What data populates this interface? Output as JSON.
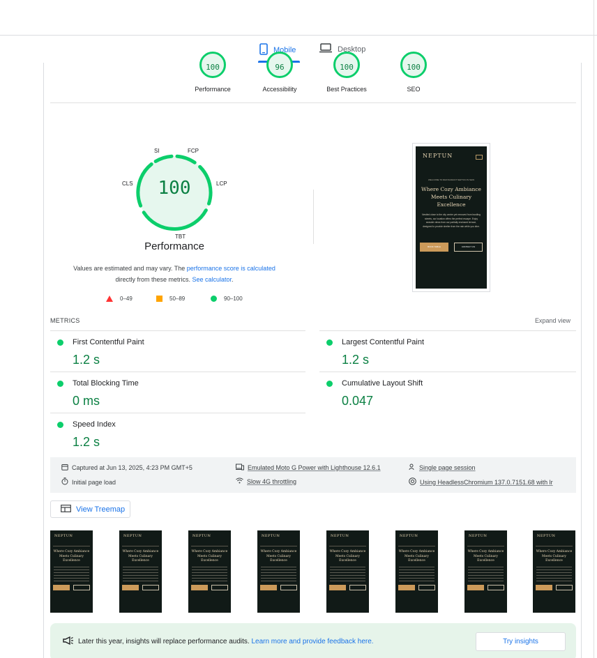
{
  "tabs": {
    "mobile": "Mobile",
    "desktop": "Desktop"
  },
  "categories": [
    {
      "score": "100",
      "label": "Performance"
    },
    {
      "score": "96",
      "label": "Accessibility"
    },
    {
      "score": "100",
      "label": "Best Practices"
    },
    {
      "score": "100",
      "label": "SEO"
    }
  ],
  "performance": {
    "score": "100",
    "title": "Performance",
    "gauge_labels": {
      "si": "SI",
      "fcp": "FCP",
      "lcp": "LCP",
      "tbt": "TBT",
      "cls": "CLS"
    },
    "desc_before": "Values are estimated and may vary. The ",
    "desc_link1": "performance score is calculated",
    "desc_middle": " directly from these metrics. ",
    "desc_link2": "See calculator",
    "desc_end": ".",
    "legend": {
      "fail": "0–49",
      "average": "50–89",
      "pass": "90–100"
    },
    "colors": {
      "pass": "#0cce6b",
      "average": "#ffa400",
      "fail": "#ff3333"
    }
  },
  "screenshot": {
    "logo": "NEPTUN",
    "welcome": "WELCOME TO RESTAURANT NEPTUN IN NEW",
    "heading": "Where Cozy Ambiance Meets Culinary Excellence",
    "text": "Nestled close to the city center yet removed from bustling streets, our location offers the perfect escape. Enjoy seaside views from our partially enclosed terrace, designed to provide shelter from the rain while you dine.",
    "btn1": "BOOK TABLE",
    "btn2": "CONTACT US"
  },
  "metrics": {
    "section_label": "METRICS",
    "expand_label": "Expand view",
    "fcp": {
      "name": "First Contentful Paint",
      "value": "1.2 s"
    },
    "lcp": {
      "name": "Largest Contentful Paint",
      "value": "1.2 s"
    },
    "tbt": {
      "name": "Total Blocking Time",
      "value": "0 ms"
    },
    "cls": {
      "name": "Cumulative Layout Shift",
      "value": "0.047"
    },
    "si": {
      "name": "Speed Index",
      "value": "1.2 s"
    }
  },
  "info": {
    "captured": "Captured at Jun 13, 2025, 4:23 PM GMT+5",
    "device": "Emulated Moto G Power with Lighthouse 12.6.1",
    "session": "Single page session",
    "load": "Initial page load",
    "throttling": "Slow 4G throttling",
    "browser": "Using HeadlessChromium 137.0.7151.68 with lr"
  },
  "treemap_label": "View Treemap",
  "filmstrip": {
    "logo": "NEPTUN",
    "heading": "Where Cozy Ambiance Meets Culinary Excellence"
  },
  "insights": {
    "text": "Later this year, insights will replace performance audits. ",
    "link": "Learn more and provide feedback here.",
    "button": "Try insights"
  }
}
